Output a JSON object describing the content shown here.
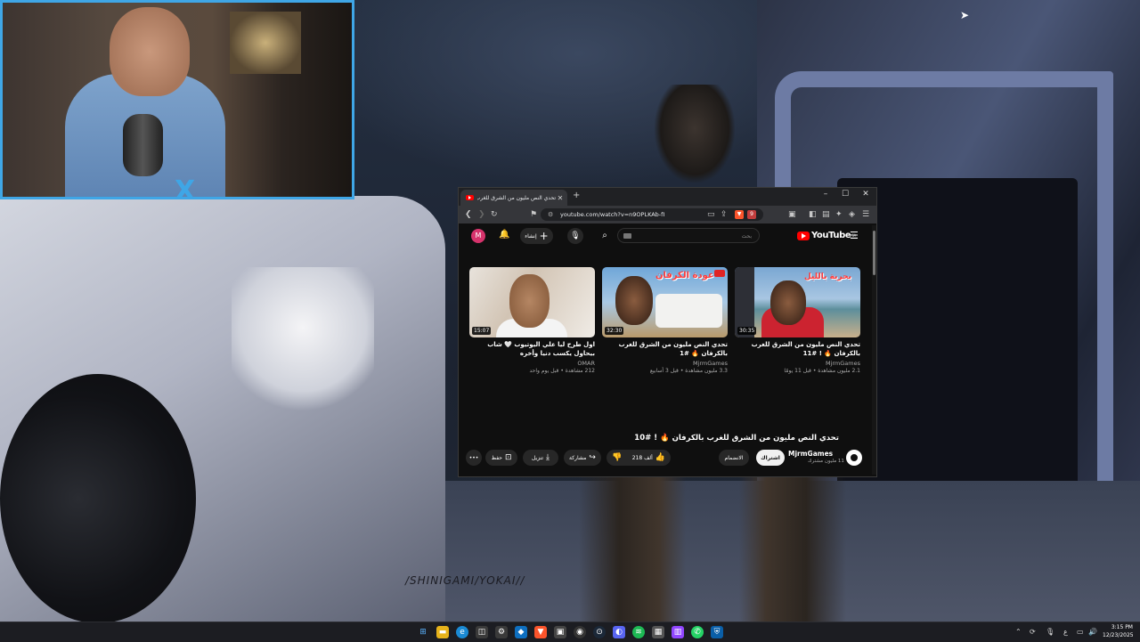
{
  "overlay": {
    "logo_letter": "X",
    "brand_text": "/SHINIGAMI/YOKAI//"
  },
  "browser": {
    "tab_title": "تحدي النص مليون من الشرق للغرب بالكرفان | YouTube",
    "url": "youtube.com/watch?v=n9OPLKAb-fI",
    "window_controls": [
      "–",
      "☐",
      "✕"
    ],
    "extensions_badge": "9"
  },
  "youtube": {
    "avatar_letter": "M",
    "create_label": "إنشاء",
    "search_placeholder": "بحث",
    "logo_text": "YouTube",
    "logo_region": "SA",
    "recommendations": [
      {
        "title": "اول طرح ليا علي اليوتيوب 🤍 شاب بيحاول يكسب دنيا وأخره",
        "channel": "OMAR",
        "meta": "212 مشاهدة • قبل يوم واحد",
        "duration": "15:07"
      },
      {
        "title": "تحدي النص مليون من الشرق للغرب بالكرفان 🔥 #1",
        "channel": "MjrmGames",
        "meta": "3.3 مليون مشاهدة • قبل 3 أسابيع",
        "duration": "32:30",
        "thumb_text": "عودة الكرفان"
      },
      {
        "title": "تحدي النص مليون من الشرق للغرب بالكرفان 🔥 ! #11",
        "channel": "MjrmGames",
        "meta": "2.1 مليون مشاهدة • قبل 11 يومًا",
        "duration": "30:35",
        "thumb_text": "بحرية بالليل"
      }
    ],
    "watch": {
      "title": "تحدي النص مليون من الشرق للغرب بالكرفان 🔥 ! #10",
      "channel": "MjrmGames",
      "subscribers": "11 مليون مشترك",
      "join_label": "الانضمام",
      "subscribe_label": "اشتراك",
      "likes": "218 ألف",
      "share_label": "مشاركة",
      "download_label": "تنزيل",
      "save_label": "حفظ"
    }
  },
  "taskbar": {
    "apps": [
      "windows-start",
      "task-view",
      "file-explorer",
      "edge",
      "store",
      "settings",
      "vscode",
      "brave",
      "chat",
      "obs",
      "steam",
      "discord",
      "spotify",
      "notion",
      "twitch",
      "whatsapp",
      "defender"
    ],
    "lang": "ع",
    "time": "3:15 PM",
    "date": "12/23/2025"
  },
  "colors": {
    "accent_webcam": "#3fa6e6",
    "youtube_red": "#ff0000",
    "yt_bg": "#0f0f0f"
  }
}
